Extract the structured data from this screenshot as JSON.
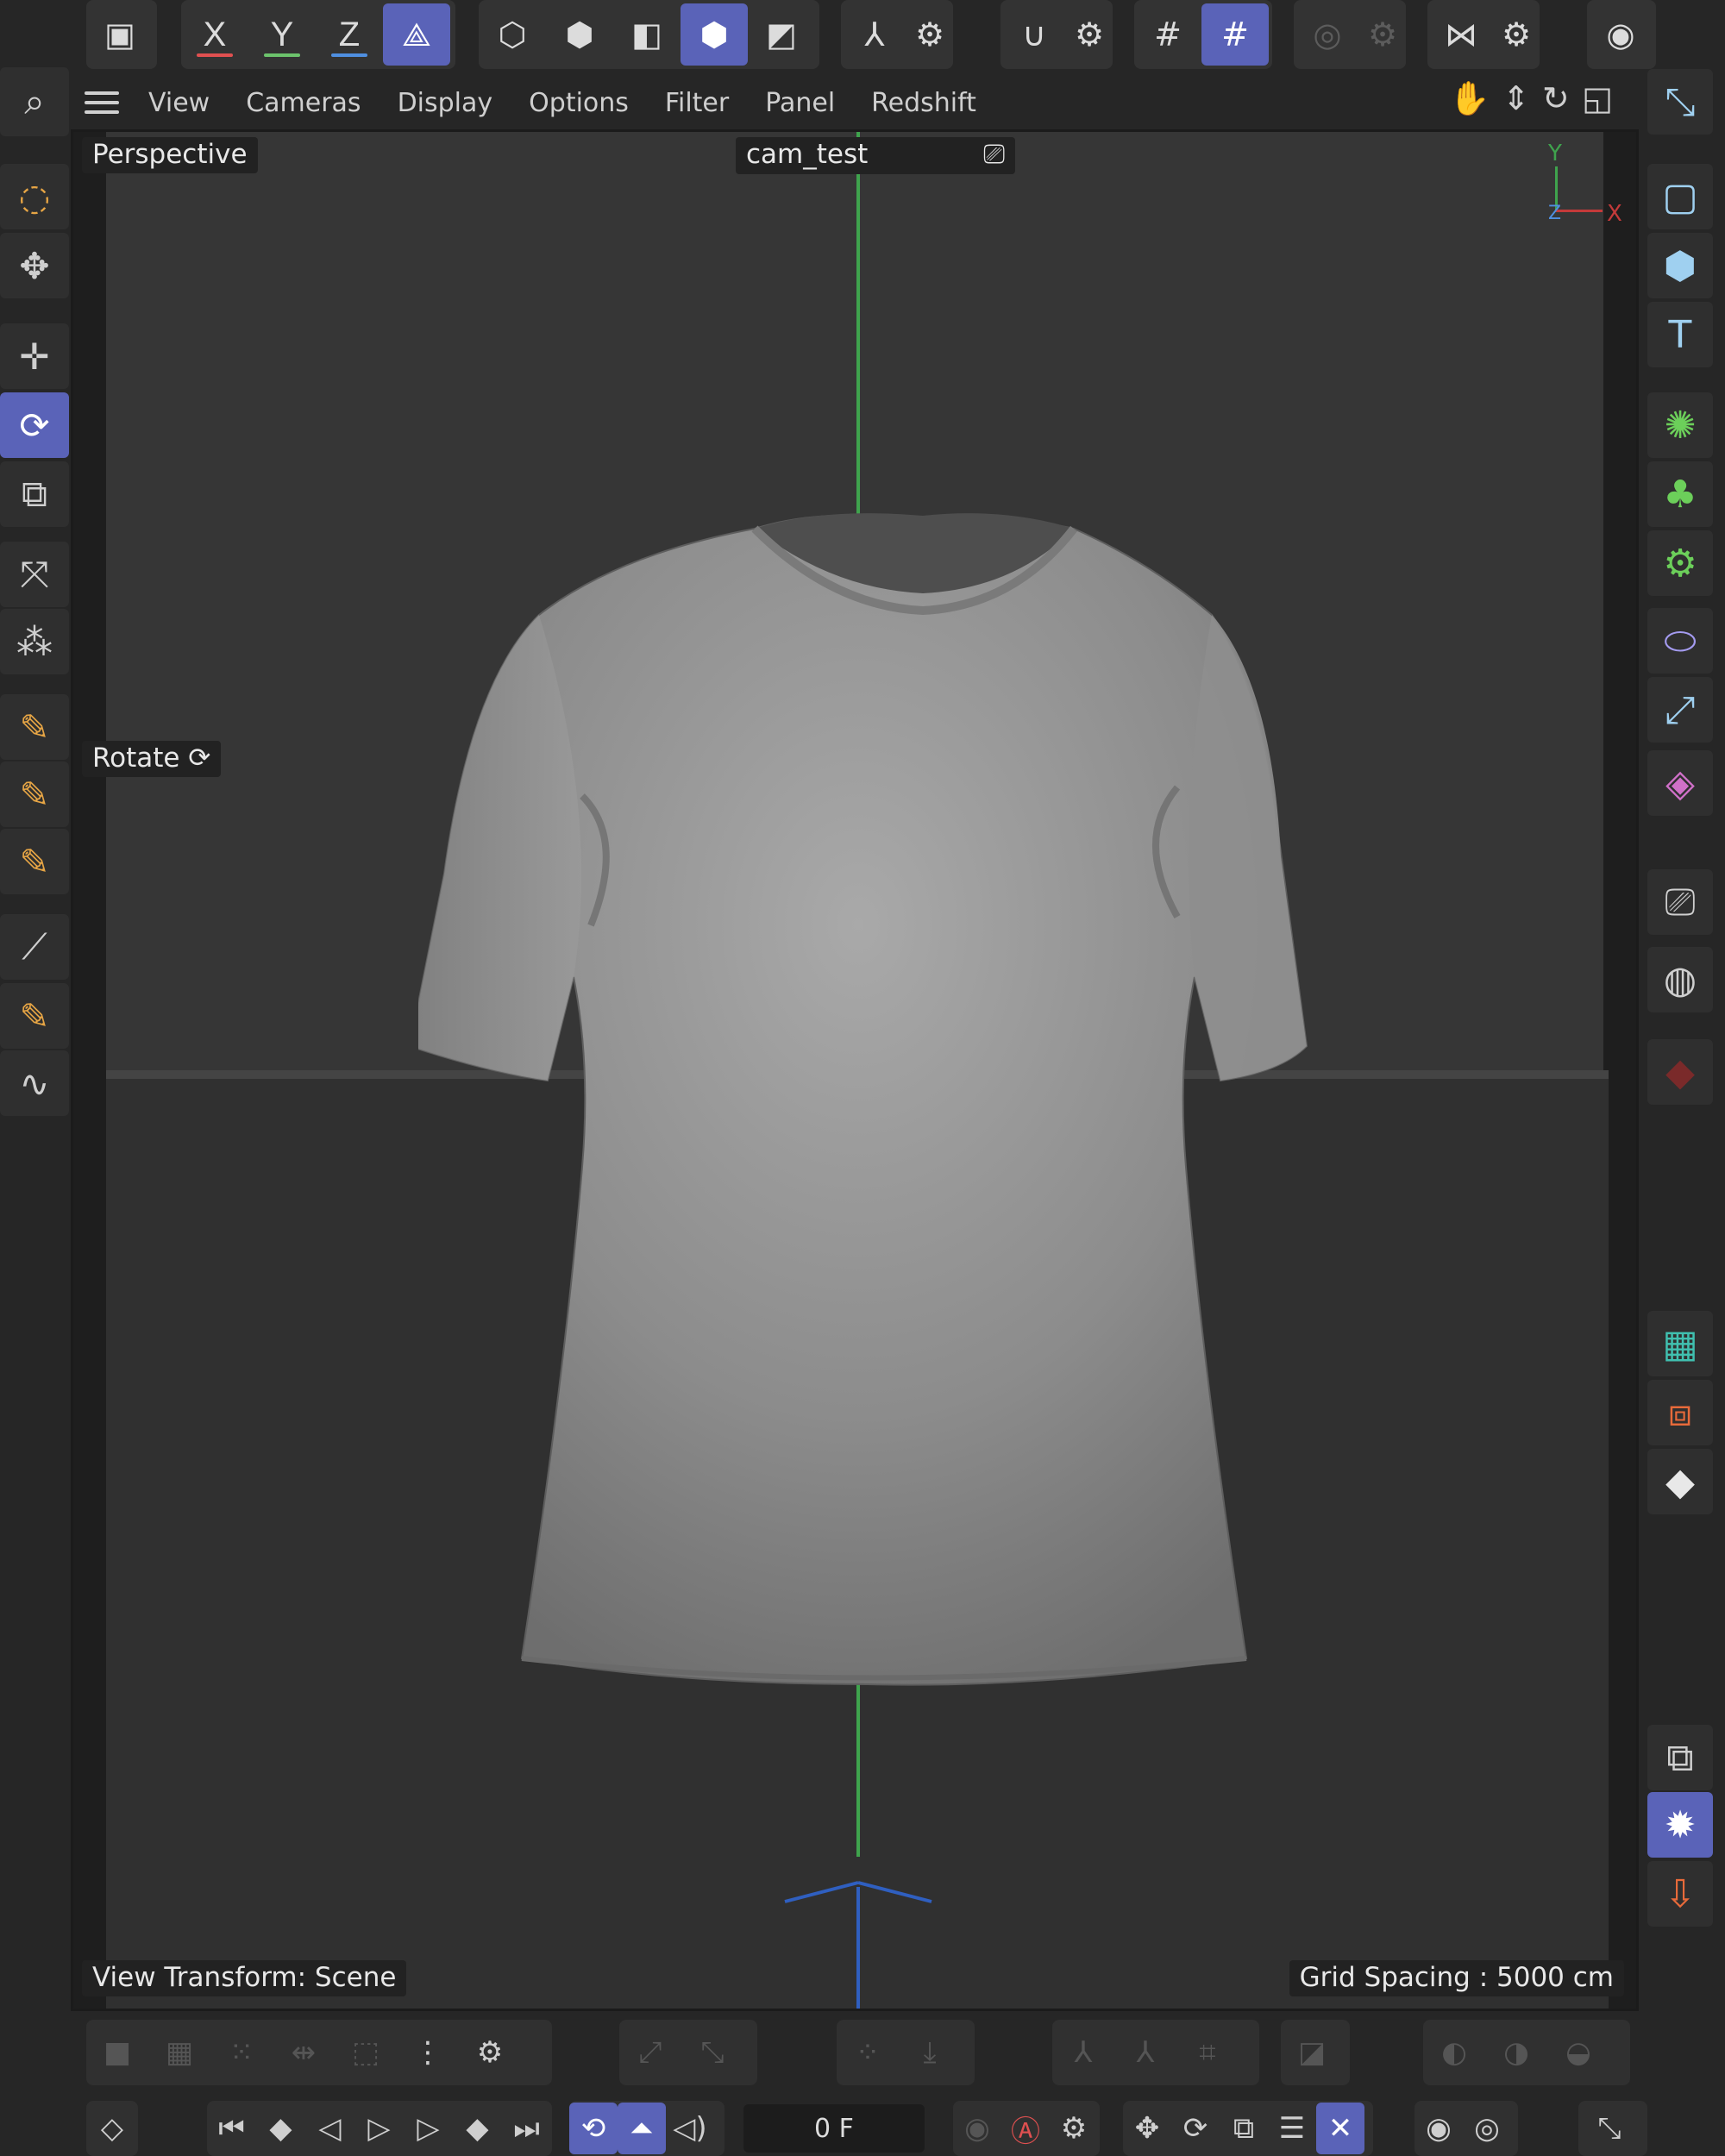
{
  "top_toolbar": {
    "axis_x": "X",
    "axis_y": "Y",
    "axis_z": "Z",
    "axis_colors": {
      "x": "#e05050",
      "y": "#6cc36c",
      "z": "#4f8fe0"
    },
    "accent": "#5a63b8"
  },
  "menu": {
    "items": [
      "View",
      "Cameras",
      "Display",
      "Options",
      "Filter",
      "Panel",
      "Redshift"
    ]
  },
  "viewport": {
    "mode": "Perspective",
    "camera": "cam_test",
    "tool_hint": "Rotate",
    "view_transform": "View Transform: Scene",
    "grid_spacing": "Grid Spacing : 5000 cm",
    "axis_y_label": "Y",
    "axis_x_label": "X",
    "axis_z_label": "Z"
  },
  "timeline": {
    "frame": "0 F"
  },
  "icons": {
    "left_tools": [
      "zoom-icon",
      "live-selection-icon",
      "select-tool-icon",
      "move-icon",
      "rotate-icon",
      "scale-icon",
      "axis-move-icon",
      "multi-move-icon",
      "pen-icon",
      "point-pen-icon",
      "spline-pen-icon",
      "brush-icon",
      "sketch-icon",
      "spline-draw-icon"
    ],
    "right_tools": [
      "coordinate-icon",
      "cube-outline-icon",
      "cube-icon",
      "text-icon",
      "generator-icon",
      "cloner-icon",
      "deformer-icon",
      "field-icon",
      "spline-icon",
      "mograph-icon",
      "camera-icon",
      "sky-icon",
      "redshift-icon",
      "asset-icon",
      "scene-nodes-icon",
      "floor-icon",
      "picture-viewer-icon",
      "render-settings-icon",
      "render-export-icon"
    ]
  }
}
